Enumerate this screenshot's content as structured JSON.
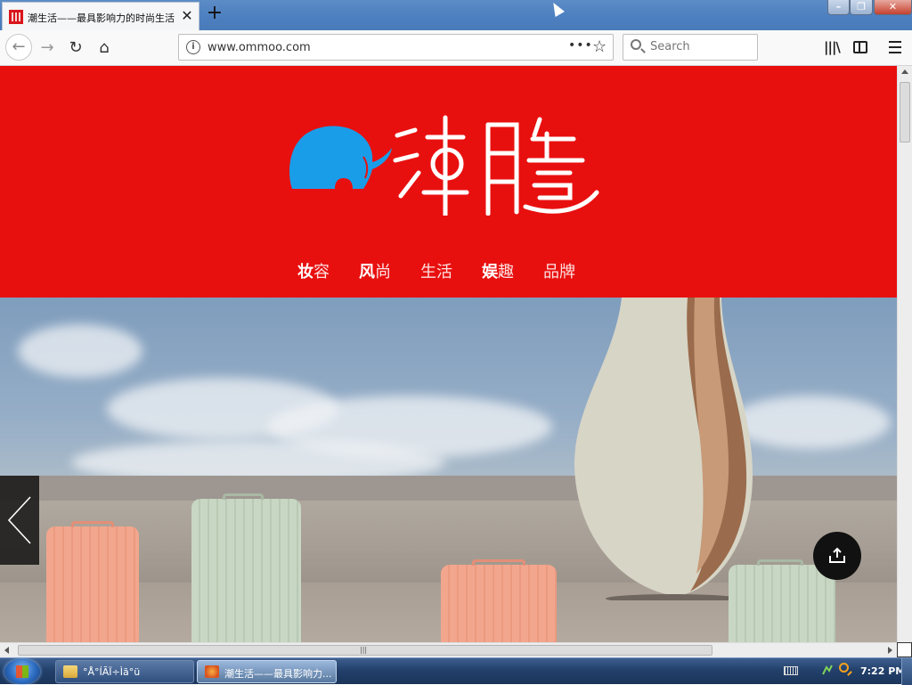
{
  "browser": {
    "tab": {
      "title": "潮生活——最具影响力的时尚生活"
    },
    "address_bar": {
      "url": "www.ommoo.com"
    },
    "search_bar": {
      "placeholder": "Search"
    }
  },
  "site": {
    "nav": [
      {
        "first": "妆",
        "rest": "容"
      },
      {
        "first": "风",
        "rest": "尚"
      },
      {
        "first": "生",
        "rest": "活"
      },
      {
        "first": "娱",
        "rest": "趣"
      },
      {
        "first": "品",
        "rest": "牌"
      }
    ]
  },
  "taskbar": {
    "tasks": [
      {
        "label": "°Å°ÍÃÏ÷Ìã°ü"
      },
      {
        "label": "潮生活——最具影响力..."
      }
    ],
    "clock": "7:22 PM"
  },
  "colors": {
    "header_red": "#e8100f",
    "logo_blue": "#1a9de8"
  }
}
